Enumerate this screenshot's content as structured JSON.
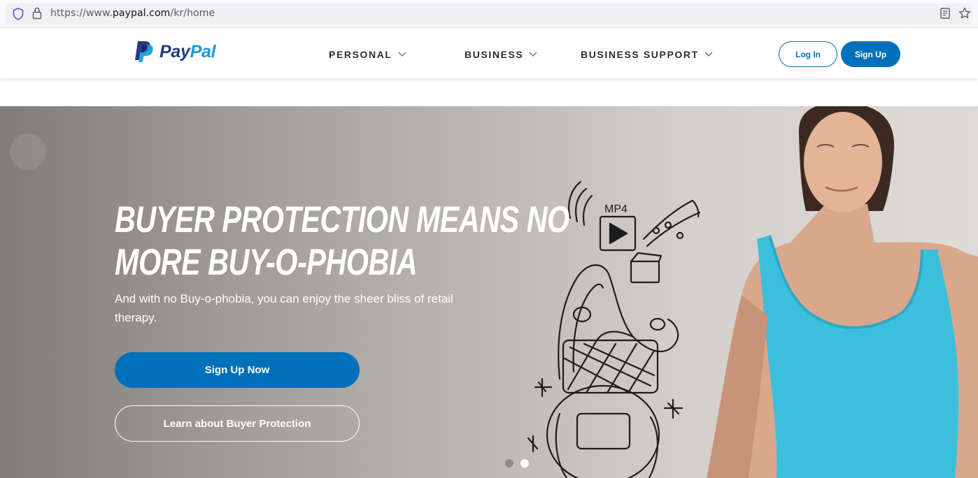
{
  "browser": {
    "url_prefix": "https://www.",
    "url_host": "paypal.com",
    "url_path": "/kr/home",
    "icons": [
      "shield-icon",
      "lock-icon",
      "reader-view-icon",
      "bookmark-star-icon"
    ]
  },
  "header": {
    "logo_text_pay": "Pay",
    "logo_text_pal": "Pal",
    "nav": [
      {
        "label": "PERSONAL",
        "icon": "chevron-down-icon"
      },
      {
        "label": "BUSINESS",
        "icon": "chevron-down-icon"
      },
      {
        "label": "BUSINESS SUPPORT",
        "icon": "chevron-down-icon"
      }
    ],
    "login_label": "Log In",
    "signup_label": "Sign Up"
  },
  "hero": {
    "headline_line1": "BUYER PROTECTION MEANS NO",
    "headline_line2": "MORE BUY-O-PHOBIA",
    "subtext": "And with no Buy-o-phobia, you can enjoy the sheer bliss of retail therapy.",
    "primary_cta": "Sign Up Now",
    "secondary_cta": "Learn about Buyer Protection",
    "doodle_label": "MP4",
    "carousel": {
      "slides": 2,
      "active": 2
    }
  },
  "colors": {
    "brand_blue": "#0070ba",
    "logo_dark": "#253b80",
    "logo_light": "#179bd7",
    "tank_top": "#3bbfdc"
  }
}
